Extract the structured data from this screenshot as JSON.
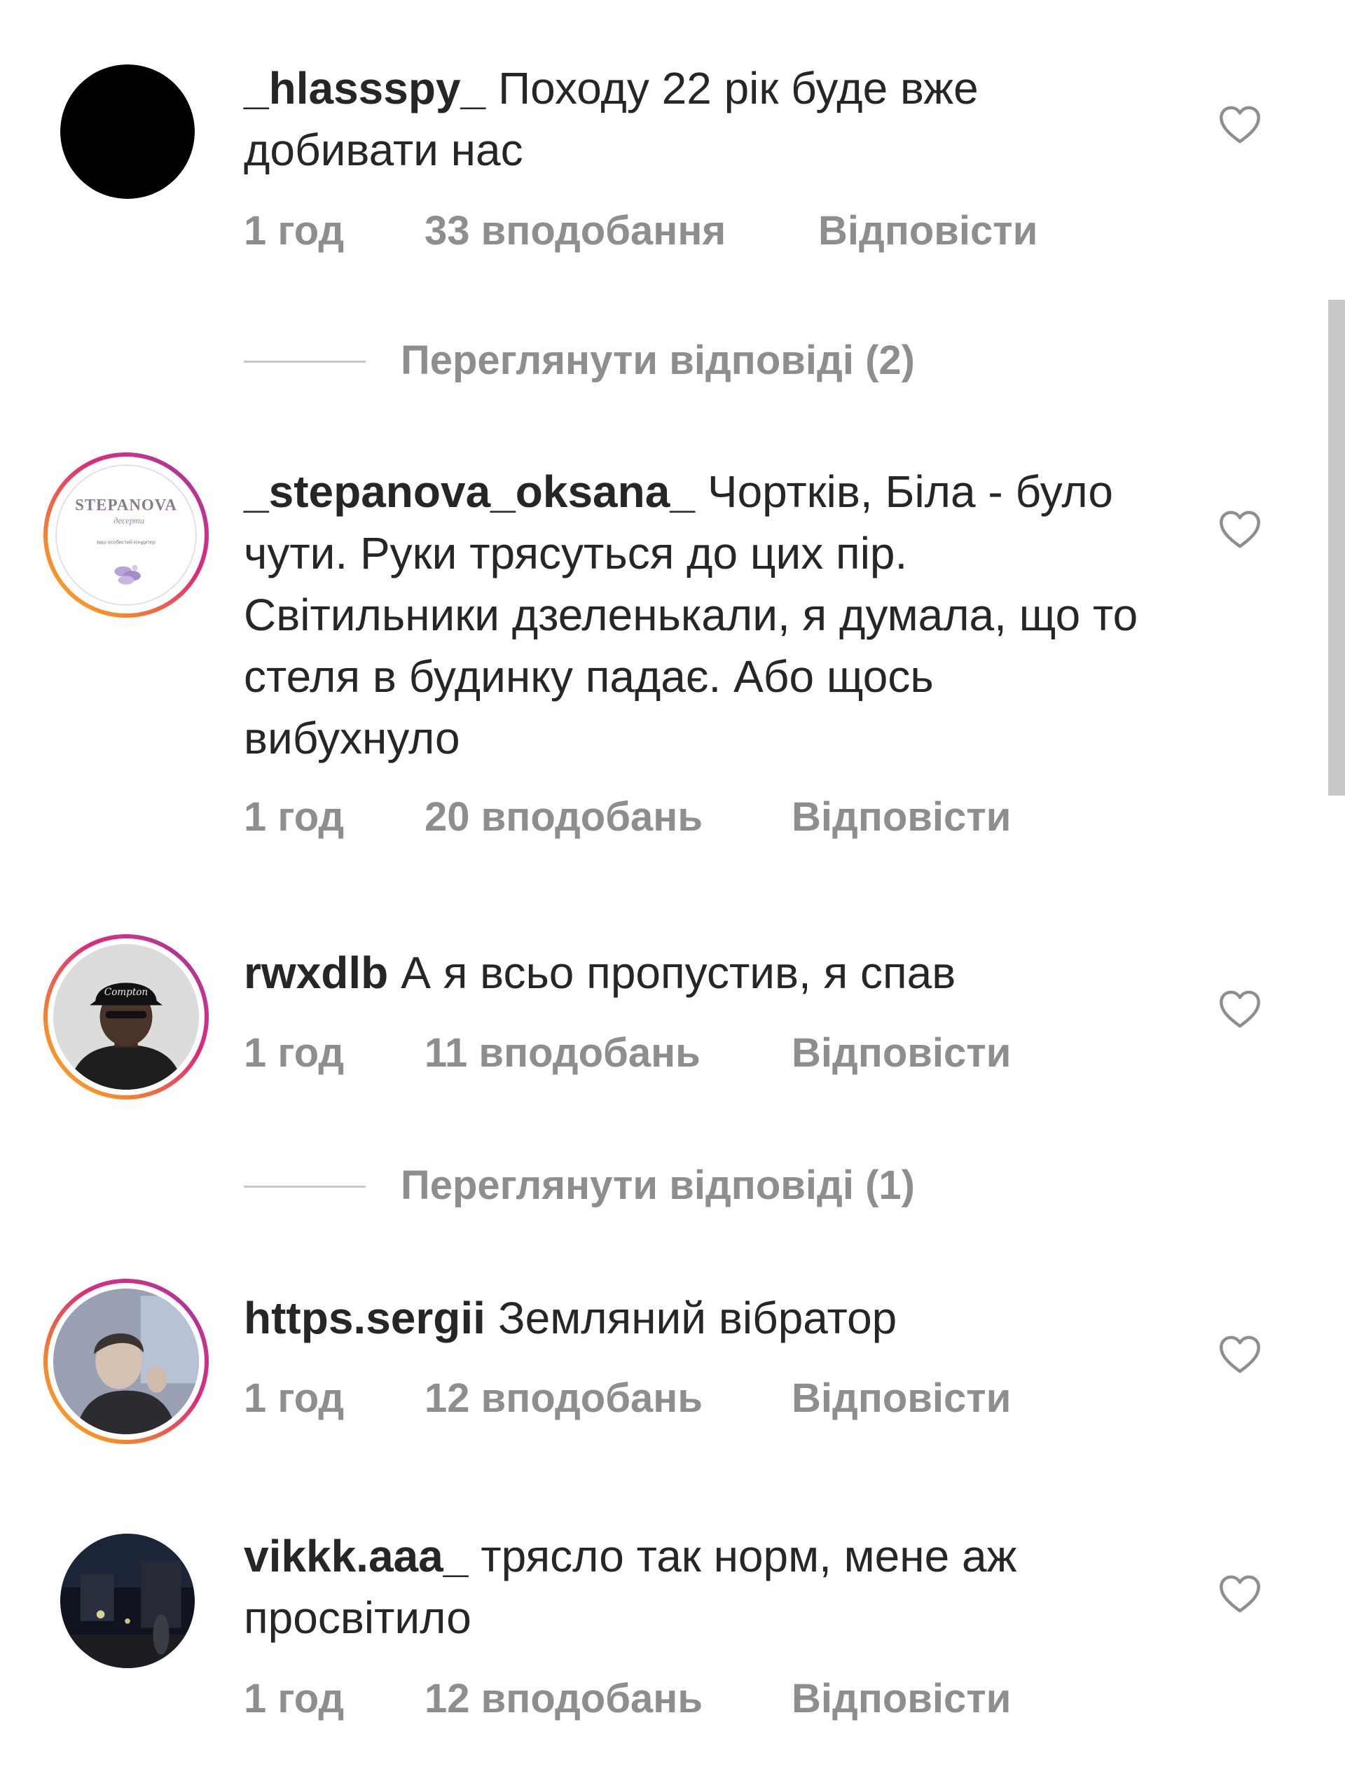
{
  "comments": [
    {
      "username": "_hlassspy_",
      "text": "Походу 22 рік буде вже добивати нас",
      "time": "1 год",
      "likes": "33 вподобання",
      "reply": "Відповісти",
      "avatar": "black-circle-avatar"
    },
    {
      "username": "_stepanova_oksana_",
      "text": "Чортків, Біла - було чути. Руки трясуться до цих пір. Світильники дзеленькали, я думала, що то стеля в будинку падає. Або щось вибухнуло",
      "time": "1 год",
      "likes": "20 вподобань",
      "reply": "Відповісти",
      "avatar": "stepanova-logo-avatar",
      "logo_title": "STEPANOVA",
      "logo_sub": "десерти",
      "logo_tagline": "ваш особистий кондитер"
    },
    {
      "username": "rwxdlb",
      "text": "А я всьо пропустив, я спав",
      "time": "1 год",
      "likes": "11 вподобань",
      "reply": "Відповісти",
      "avatar": "man-with-cap-avatar"
    },
    {
      "username": "https.sergii",
      "text": "Земляний вібратор",
      "time": "1 год",
      "likes": "12 вподобань",
      "reply": "Відповісти",
      "avatar": "young-man-avatar"
    },
    {
      "username": "vikkk.aaa_",
      "text": "трясло так норм, мене аж просвітило",
      "time": "1 год",
      "likes": "12 вподобань",
      "reply": "Відповісти",
      "avatar": "night-street-avatar"
    }
  ],
  "view_replies": [
    {
      "label": "Переглянути відповіді (2)"
    },
    {
      "label": "Переглянути відповіді (1)"
    }
  ],
  "colors": {
    "text": "#262626",
    "secondary": "#8e8e8e",
    "divider": "#c7c7c7",
    "story_ring_start": "#f9b233",
    "story_ring_end": "#8134af"
  }
}
